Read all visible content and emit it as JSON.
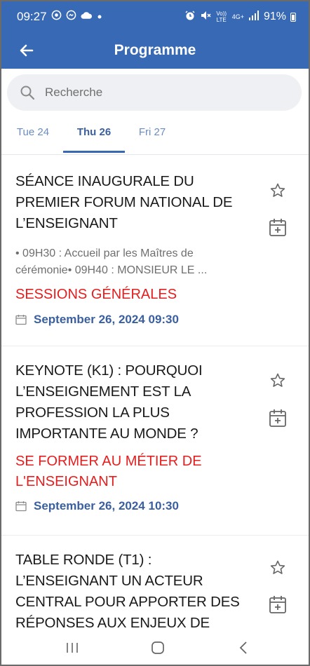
{
  "status_bar": {
    "time": "09:27",
    "left_icons": [
      "whatsapp-icon",
      "messenger-icon",
      "cloud-icon",
      "dot-icon"
    ],
    "right_icons": [
      "alarm-icon",
      "mute-icon",
      "volte-icon",
      "4g-icon",
      "signal-icon"
    ],
    "volte_text": "Vo)) LTE",
    "network_text": "4G+",
    "battery": "91%"
  },
  "app_bar": {
    "title": "Programme",
    "back_icon": "arrow-left-icon",
    "color": "#3869b5"
  },
  "search": {
    "placeholder": "Recherche",
    "value": "",
    "icon": "search-icon"
  },
  "tabs": [
    {
      "label": "Tue 24",
      "active": false
    },
    {
      "label": "Thu 26",
      "active": true
    },
    {
      "label": "Fri 27",
      "active": false
    }
  ],
  "sessions": [
    {
      "title": "SÉANCE INAUGURALE DU PREMIER FORUM NATIONAL DE L’ENSEIGNANT",
      "description": "• 09H30 : Accueil par les Maîtres de cérémonie• 09H40 : MONSIEUR LE ...",
      "track": "SESSIONS GÉNÉRALES",
      "date": "September 26, 2024 09:30",
      "favorite": false
    },
    {
      "title": "KEYNOTE (K1) : POURQUOI L’ENSEIGNEMENT EST LA PROFESSION LA PLUS IMPORTANTE AU MONDE ?",
      "description": "",
      "track": "SE FORMER AU MÉTIER DE L'ENSEIGNANT",
      "date": "September 26, 2024 10:30",
      "favorite": false
    },
    {
      "title": "TABLE RONDE (T1) : L’ENSEIGNANT UN ACTEUR CENTRAL POUR APPORTER DES RÉPONSES AUX ENJEUX DE",
      "description": "",
      "track": "",
      "date": "",
      "favorite": false
    }
  ],
  "colors": {
    "accent": "#3869b5",
    "track": "#e41e1e",
    "date": "#3a5f9f"
  },
  "nav_bar": [
    "recent-apps-icon",
    "home-icon",
    "back-icon"
  ]
}
